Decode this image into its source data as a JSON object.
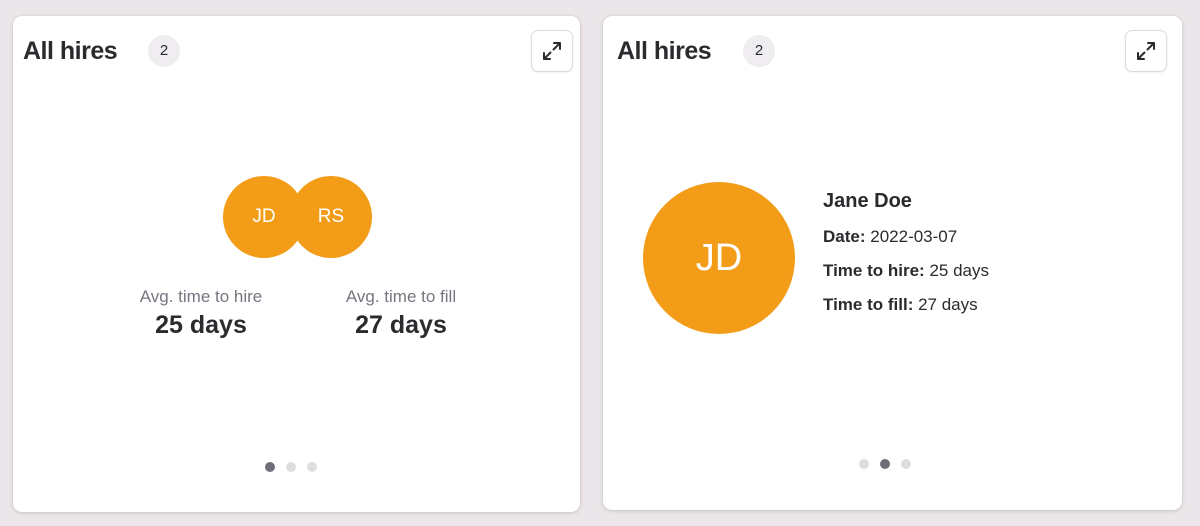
{
  "colors": {
    "accent": "#f39c18",
    "page_background": "#ebe6e9",
    "card_background": "#ffffff",
    "text_primary": "#2b2b2f",
    "text_muted": "#767680",
    "dot_active": "#6f6e78",
    "dot_inactive": "#dedde0"
  },
  "cards": [
    {
      "title": "All hires",
      "count": "2",
      "expand_icon": "expand-arrows-icon",
      "avatars": [
        "JD",
        "RS"
      ],
      "stats": [
        {
          "label": "Avg. time to hire",
          "value": "25 days"
        },
        {
          "label": "Avg. time to fill",
          "value": "27 days"
        }
      ],
      "pager": {
        "total": 3,
        "active_index": 0
      }
    },
    {
      "title": "All hires",
      "count": "2",
      "expand_icon": "expand-arrows-icon",
      "avatar": "JD",
      "person": {
        "name": "Jane Doe",
        "details": [
          {
            "label": "Date:",
            "value": "2022-03-07"
          },
          {
            "label": "Time to hire:",
            "value": "25 days"
          },
          {
            "label": "Time to fill:",
            "value": "27 days"
          }
        ]
      },
      "pager": {
        "total": 3,
        "active_index": 1
      }
    }
  ]
}
